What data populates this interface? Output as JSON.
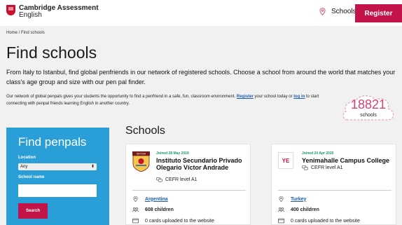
{
  "header": {
    "logo_line1": "Cambridge Assessment",
    "logo_line2": "English",
    "schools_link": "Schools",
    "register_button": "Register"
  },
  "breadcrumb": "Home / Find schools",
  "page_title": "Find schools",
  "intro": "From Italy to Istanbul, find global penfriends in our network of registered schools. Choose a school from around the world that matches your class's age group and size with our pen pal finder.",
  "info": {
    "before_register": "Our network of global penpals gives your students the opportunity to find a penfriend in a safe, fun, classroom environment. ",
    "register_link": "Register",
    "between": " your school today or ",
    "login_link": "log in",
    "after": " to start connecting with penpal friends learning English in another country."
  },
  "counter": {
    "value": "18821",
    "label": "schools"
  },
  "finder": {
    "title": "Find penpals",
    "location_label": "Location",
    "location_value": "Any",
    "school_name_label": "School name",
    "school_name_value": "",
    "search_button": "Search"
  },
  "schools": {
    "title": "Schools",
    "cards": [
      {
        "joined": "Joined 28 May 2019",
        "name": "Instituto Secundario Privado Olegario Víctor Andrade",
        "cefr": "CEFR level A1",
        "country": "Argentina",
        "children": "608 children",
        "cards_uploaded": "0 cards uploaded to the website",
        "logo_text": "ISPOVA"
      },
      {
        "joined": "Joined 24 Apr 2020",
        "name": "Yenimahalle Campus College",
        "cefr": "CEFR level A1",
        "country": "Turkey",
        "children": "400 children",
        "cards_uploaded": "0 cards uploaded to the website",
        "logo_text": "YE"
      }
    ]
  },
  "colors": {
    "brand": "#c3144a",
    "panel": "#2a9ed7",
    "link": "#1a5fb4",
    "accent_green": "#1a9a6b"
  }
}
